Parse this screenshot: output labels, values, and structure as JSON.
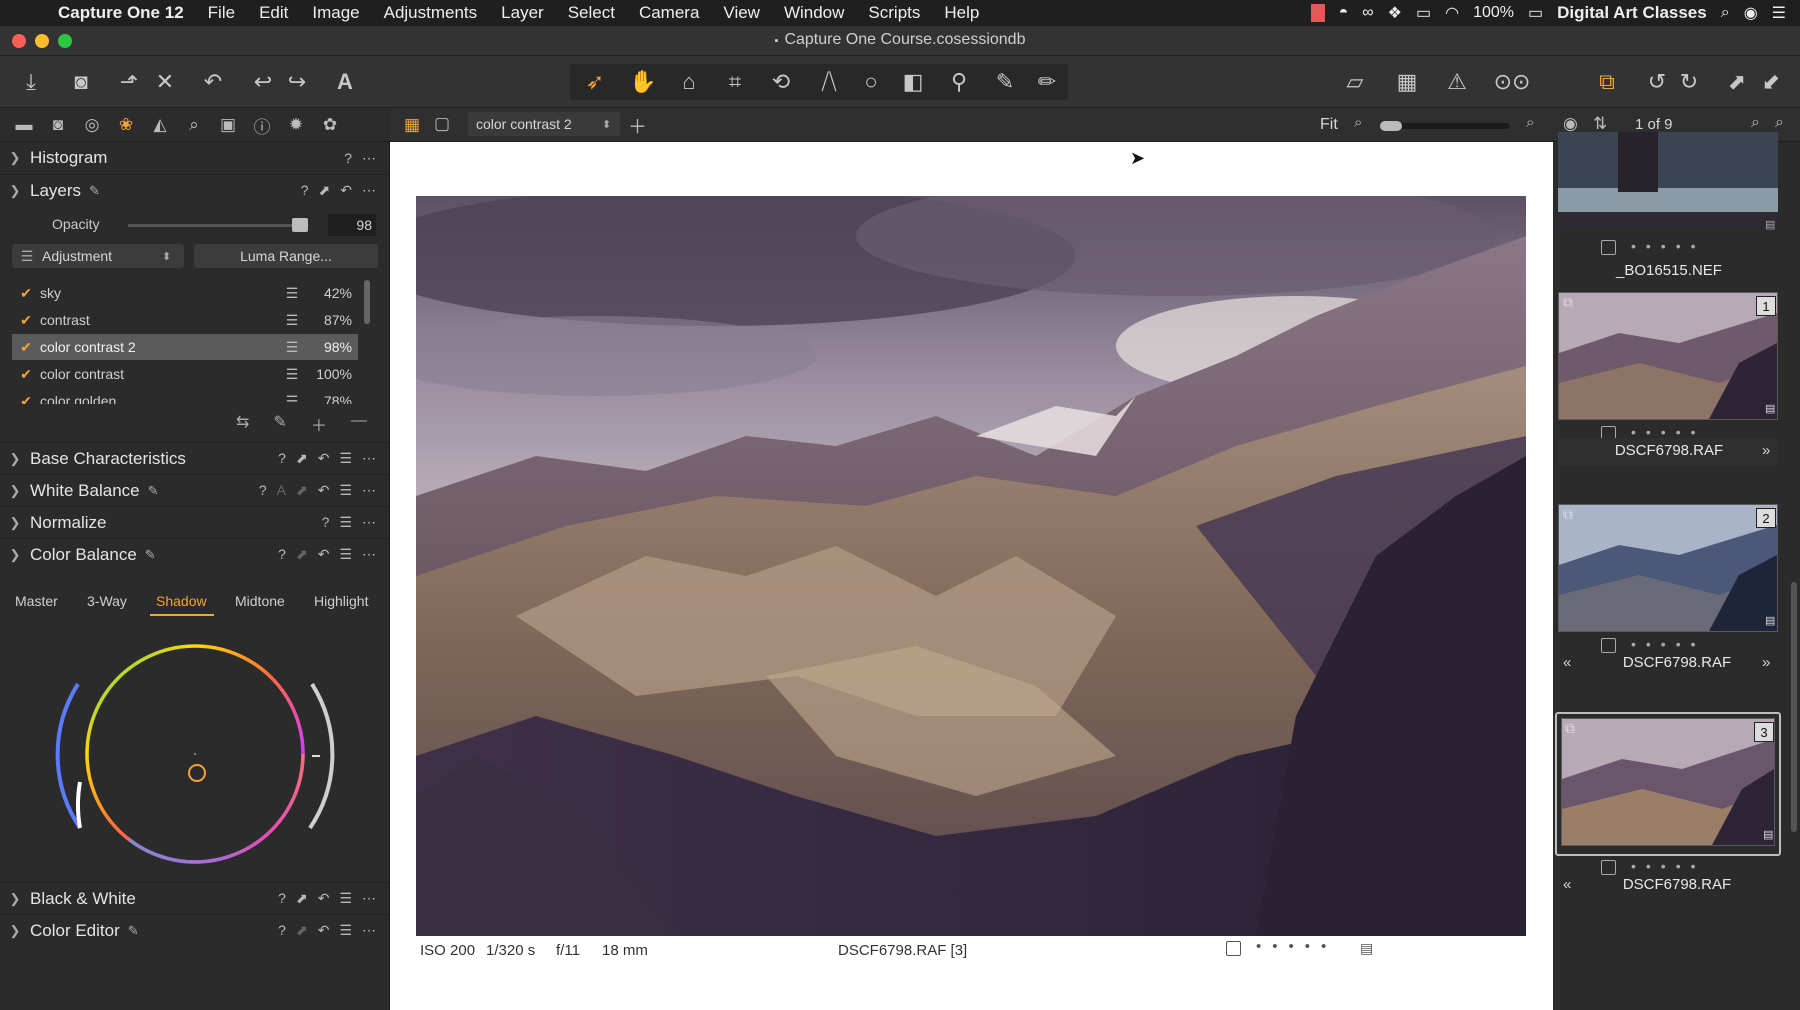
{
  "menubar": {
    "app_name": "Capture One 12",
    "menus": [
      "File",
      "Edit",
      "Image",
      "Adjustments",
      "Layer",
      "Select",
      "Camera",
      "View",
      "Window",
      "Scripts",
      "Help"
    ],
    "battery": "100%",
    "user": "Digital Art Classes"
  },
  "window": {
    "title": "Capture One Course.cosessiondb"
  },
  "viewer": {
    "variant_select": "color contrast 2",
    "zoom_label": "Fit",
    "counter": "1 of 9",
    "info": {
      "iso": "ISO 200",
      "shutter": "1/320 s",
      "aperture": "f/11",
      "focal": "18 mm",
      "filename": "DSCF6798.RAF [3]"
    }
  },
  "left": {
    "histogram": {
      "title": "Histogram"
    },
    "layers": {
      "title": "Layers",
      "opacity_label": "Opacity",
      "opacity_value": "98",
      "opacity_fraction": 0.98,
      "adjustment_select": "Adjustment",
      "luma_button": "Luma Range...",
      "items": [
        {
          "name": "sky",
          "pct": "42%"
        },
        {
          "name": "contrast",
          "pct": "87%"
        },
        {
          "name": "color contrast 2",
          "pct": "98%"
        },
        {
          "name": "color contrast",
          "pct": "100%"
        },
        {
          "name": "color golden",
          "pct": "78%"
        }
      ]
    },
    "tools": {
      "base": "Base Characteristics",
      "wb": "White Balance",
      "normalize": "Normalize",
      "color_balance": "Color Balance",
      "bw": "Black & White",
      "color_editor": "Color Editor"
    },
    "color_balance_tabs": [
      "Master",
      "3-Way",
      "Shadow",
      "Midtone",
      "Highlight"
    ],
    "color_balance_active": "Shadow"
  },
  "browser": {
    "thumbs": [
      {
        "name": "_BO16515.NEF",
        "badge": ""
      },
      {
        "name": "DSCF6798.RAF",
        "badge": "1"
      },
      {
        "name": "DSCF6798.RAF",
        "badge": "2"
      },
      {
        "name": "DSCF6798.RAF",
        "badge": "3"
      }
    ]
  },
  "colors": {
    "accent": "#f2a33a",
    "panel": "#2b2b2b",
    "selected": "#5b5b5b"
  }
}
